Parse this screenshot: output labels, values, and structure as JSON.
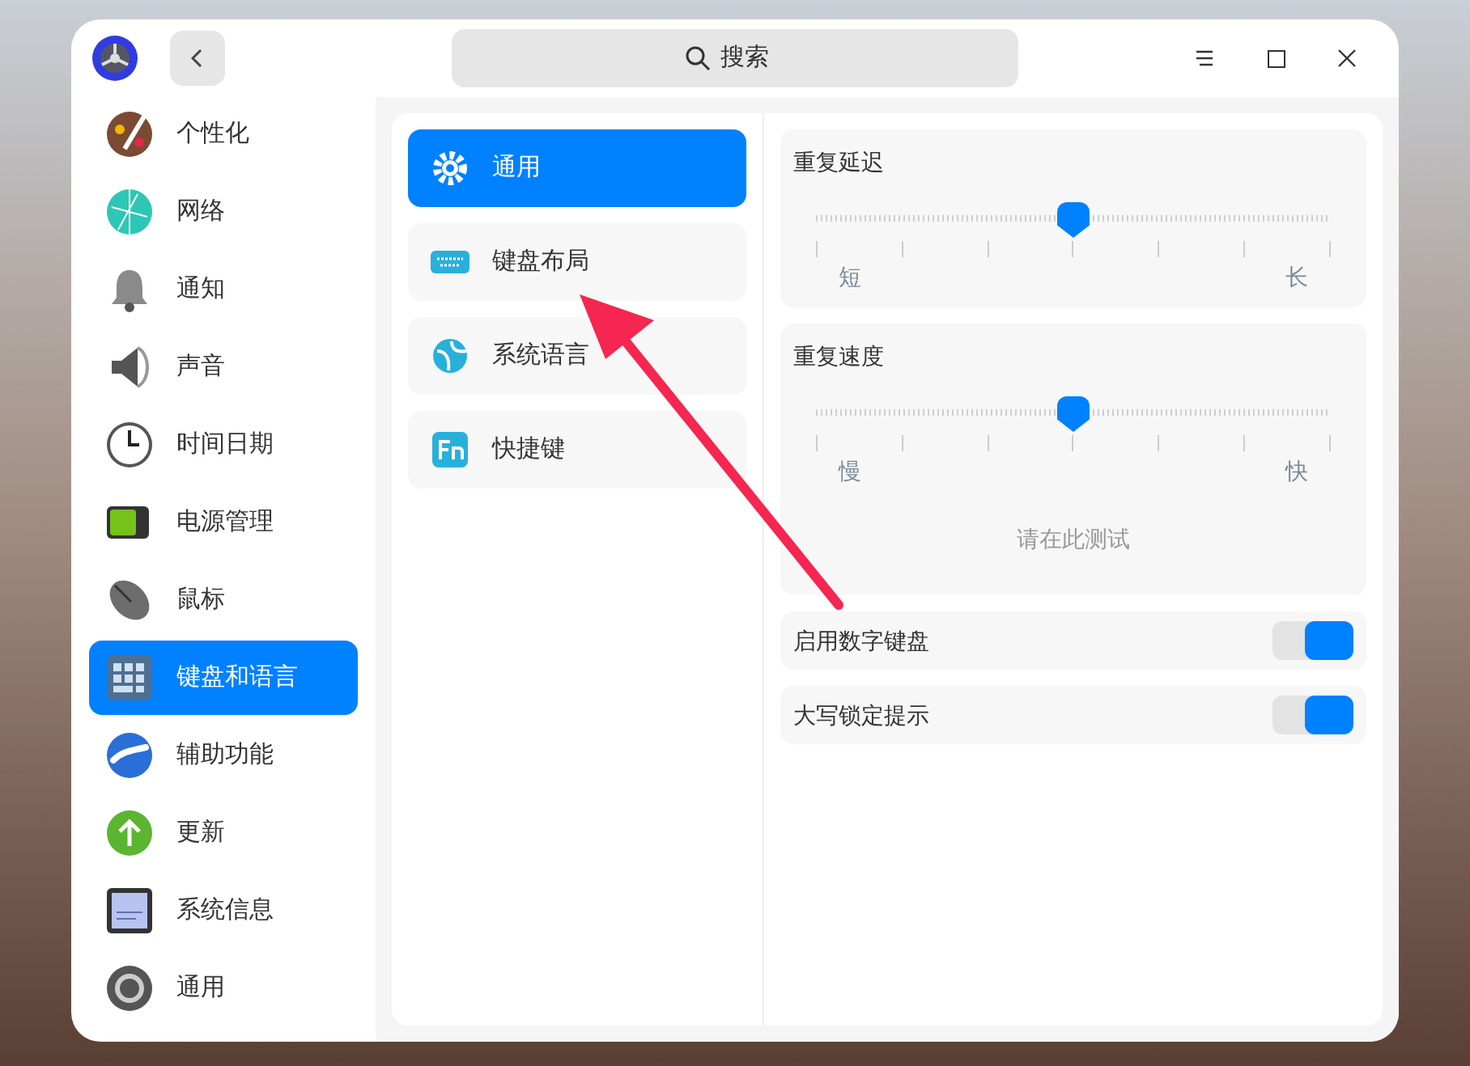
{
  "titlebar": {
    "search": {
      "placeholder": "搜索"
    }
  },
  "sidebar": {
    "items": [
      {
        "label": "个性化",
        "selected": false
      },
      {
        "label": "网络",
        "selected": false
      },
      {
        "label": "通知",
        "selected": false
      },
      {
        "label": "声音",
        "selected": false
      },
      {
        "label": "时间日期",
        "selected": false
      },
      {
        "label": "电源管理",
        "selected": false
      },
      {
        "label": "鼠标",
        "selected": false
      },
      {
        "label": "键盘和语言",
        "selected": true
      },
      {
        "label": "辅助功能",
        "selected": false
      },
      {
        "label": "更新",
        "selected": false
      },
      {
        "label": "系统信息",
        "selected": false
      },
      {
        "label": "通用",
        "selected": false
      }
    ]
  },
  "submenu": {
    "items": [
      {
        "label": "通用",
        "selected": true
      },
      {
        "label": "键盘布局",
        "selected": false
      },
      {
        "label": "系统语言",
        "selected": false
      },
      {
        "label": "快捷键",
        "selected": false
      }
    ]
  },
  "settings": {
    "sliders": [
      {
        "title": "重复延迟",
        "level": 0.5,
        "min_label": "短",
        "max_label": "长"
      },
      {
        "title": "重复速度",
        "level": 0.5,
        "min_label": "慢",
        "max_label": "快"
      }
    ],
    "test_field": {
      "placeholder": "请在此测试"
    },
    "toggles": [
      {
        "label": "启用数字键盘",
        "on": true
      },
      {
        "label": "大写锁定提示",
        "on": true
      }
    ]
  }
}
